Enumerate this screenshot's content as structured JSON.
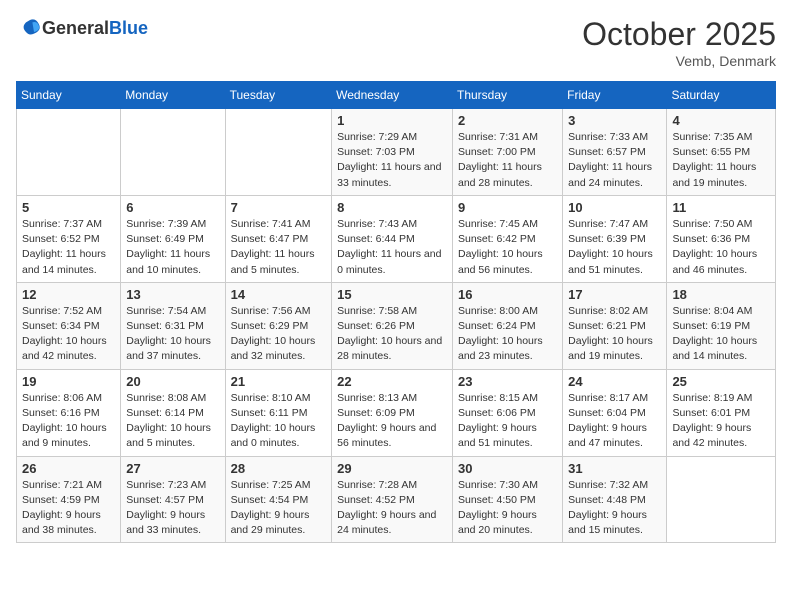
{
  "logo": {
    "text_general": "General",
    "text_blue": "Blue"
  },
  "header": {
    "month": "October 2025",
    "location": "Vemb, Denmark"
  },
  "weekdays": [
    "Sunday",
    "Monday",
    "Tuesday",
    "Wednesday",
    "Thursday",
    "Friday",
    "Saturday"
  ],
  "weeks": [
    [
      {
        "day": "",
        "info": ""
      },
      {
        "day": "",
        "info": ""
      },
      {
        "day": "",
        "info": ""
      },
      {
        "day": "1",
        "info": "Sunrise: 7:29 AM\nSunset: 7:03 PM\nDaylight: 11 hours and 33 minutes."
      },
      {
        "day": "2",
        "info": "Sunrise: 7:31 AM\nSunset: 7:00 PM\nDaylight: 11 hours and 28 minutes."
      },
      {
        "day": "3",
        "info": "Sunrise: 7:33 AM\nSunset: 6:57 PM\nDaylight: 11 hours and 24 minutes."
      },
      {
        "day": "4",
        "info": "Sunrise: 7:35 AM\nSunset: 6:55 PM\nDaylight: 11 hours and 19 minutes."
      }
    ],
    [
      {
        "day": "5",
        "info": "Sunrise: 7:37 AM\nSunset: 6:52 PM\nDaylight: 11 hours and 14 minutes."
      },
      {
        "day": "6",
        "info": "Sunrise: 7:39 AM\nSunset: 6:49 PM\nDaylight: 11 hours and 10 minutes."
      },
      {
        "day": "7",
        "info": "Sunrise: 7:41 AM\nSunset: 6:47 PM\nDaylight: 11 hours and 5 minutes."
      },
      {
        "day": "8",
        "info": "Sunrise: 7:43 AM\nSunset: 6:44 PM\nDaylight: 11 hours and 0 minutes."
      },
      {
        "day": "9",
        "info": "Sunrise: 7:45 AM\nSunset: 6:42 PM\nDaylight: 10 hours and 56 minutes."
      },
      {
        "day": "10",
        "info": "Sunrise: 7:47 AM\nSunset: 6:39 PM\nDaylight: 10 hours and 51 minutes."
      },
      {
        "day": "11",
        "info": "Sunrise: 7:50 AM\nSunset: 6:36 PM\nDaylight: 10 hours and 46 minutes."
      }
    ],
    [
      {
        "day": "12",
        "info": "Sunrise: 7:52 AM\nSunset: 6:34 PM\nDaylight: 10 hours and 42 minutes."
      },
      {
        "day": "13",
        "info": "Sunrise: 7:54 AM\nSunset: 6:31 PM\nDaylight: 10 hours and 37 minutes."
      },
      {
        "day": "14",
        "info": "Sunrise: 7:56 AM\nSunset: 6:29 PM\nDaylight: 10 hours and 32 minutes."
      },
      {
        "day": "15",
        "info": "Sunrise: 7:58 AM\nSunset: 6:26 PM\nDaylight: 10 hours and 28 minutes."
      },
      {
        "day": "16",
        "info": "Sunrise: 8:00 AM\nSunset: 6:24 PM\nDaylight: 10 hours and 23 minutes."
      },
      {
        "day": "17",
        "info": "Sunrise: 8:02 AM\nSunset: 6:21 PM\nDaylight: 10 hours and 19 minutes."
      },
      {
        "day": "18",
        "info": "Sunrise: 8:04 AM\nSunset: 6:19 PM\nDaylight: 10 hours and 14 minutes."
      }
    ],
    [
      {
        "day": "19",
        "info": "Sunrise: 8:06 AM\nSunset: 6:16 PM\nDaylight: 10 hours and 9 minutes."
      },
      {
        "day": "20",
        "info": "Sunrise: 8:08 AM\nSunset: 6:14 PM\nDaylight: 10 hours and 5 minutes."
      },
      {
        "day": "21",
        "info": "Sunrise: 8:10 AM\nSunset: 6:11 PM\nDaylight: 10 hours and 0 minutes."
      },
      {
        "day": "22",
        "info": "Sunrise: 8:13 AM\nSunset: 6:09 PM\nDaylight: 9 hours and 56 minutes."
      },
      {
        "day": "23",
        "info": "Sunrise: 8:15 AM\nSunset: 6:06 PM\nDaylight: 9 hours and 51 minutes."
      },
      {
        "day": "24",
        "info": "Sunrise: 8:17 AM\nSunset: 6:04 PM\nDaylight: 9 hours and 47 minutes."
      },
      {
        "day": "25",
        "info": "Sunrise: 8:19 AM\nSunset: 6:01 PM\nDaylight: 9 hours and 42 minutes."
      }
    ],
    [
      {
        "day": "26",
        "info": "Sunrise: 7:21 AM\nSunset: 4:59 PM\nDaylight: 9 hours and 38 minutes."
      },
      {
        "day": "27",
        "info": "Sunrise: 7:23 AM\nSunset: 4:57 PM\nDaylight: 9 hours and 33 minutes."
      },
      {
        "day": "28",
        "info": "Sunrise: 7:25 AM\nSunset: 4:54 PM\nDaylight: 9 hours and 29 minutes."
      },
      {
        "day": "29",
        "info": "Sunrise: 7:28 AM\nSunset: 4:52 PM\nDaylight: 9 hours and 24 minutes."
      },
      {
        "day": "30",
        "info": "Sunrise: 7:30 AM\nSunset: 4:50 PM\nDaylight: 9 hours and 20 minutes."
      },
      {
        "day": "31",
        "info": "Sunrise: 7:32 AM\nSunset: 4:48 PM\nDaylight: 9 hours and 15 minutes."
      },
      {
        "day": "",
        "info": ""
      }
    ]
  ]
}
